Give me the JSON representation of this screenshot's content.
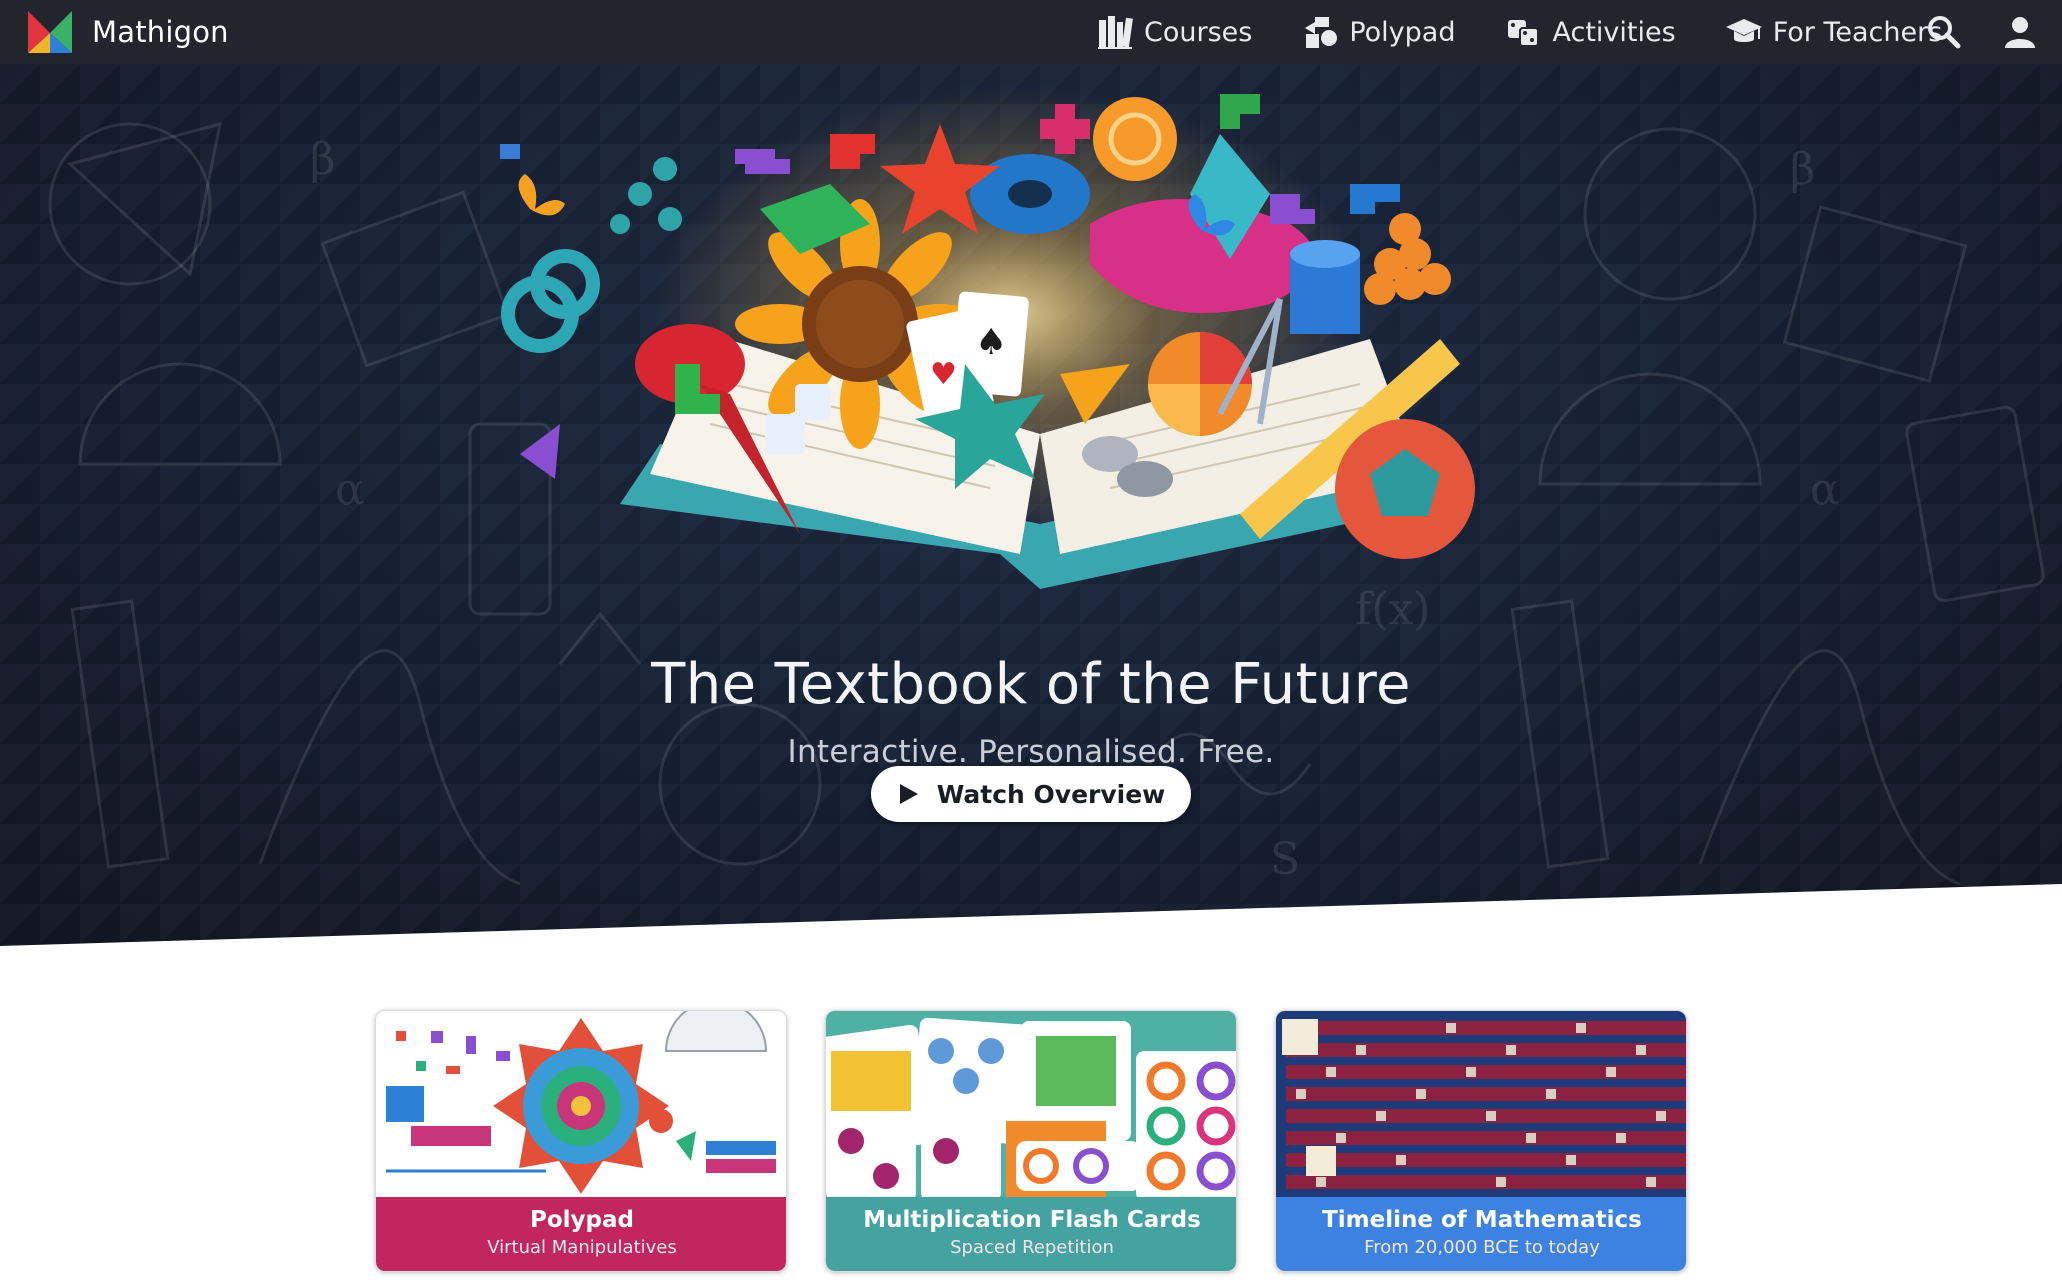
{
  "nav": {
    "brand": "Mathigon",
    "links": [
      {
        "label": "Courses",
        "icon": "books-icon"
      },
      {
        "label": "Polypad",
        "icon": "polypad-shapes-icon"
      },
      {
        "label": "Activities",
        "icon": "dice-icon"
      },
      {
        "label": "For Teachers",
        "icon": "graduation-cap-icon"
      }
    ],
    "search_icon": "search-icon",
    "account_icon": "user-icon"
  },
  "hero": {
    "title": "The Textbook of the Future",
    "subtitle": "Interactive. Personalised. Free.",
    "cta_label": "Watch Overview",
    "cta_icon": "play-icon"
  },
  "cards": [
    {
      "title": "Polypad",
      "subtitle": "Virtual Manipulatives",
      "color": "#c1275e"
    },
    {
      "title": "Multiplication Flash Cards",
      "subtitle": "Spaced Repetition",
      "color": "#44a3a0"
    },
    {
      "title": "Timeline of Mathematics",
      "subtitle": "From 20,000 BCE to today",
      "color": "#3d82e0"
    }
  ],
  "colors": {
    "nav_bg": "#22252e",
    "hero_bg": "#172235",
    "logo_red": "#e0353f",
    "logo_green": "#3ab06a",
    "logo_blue": "#2f7fd8",
    "logo_yellow": "#f1b52a"
  }
}
